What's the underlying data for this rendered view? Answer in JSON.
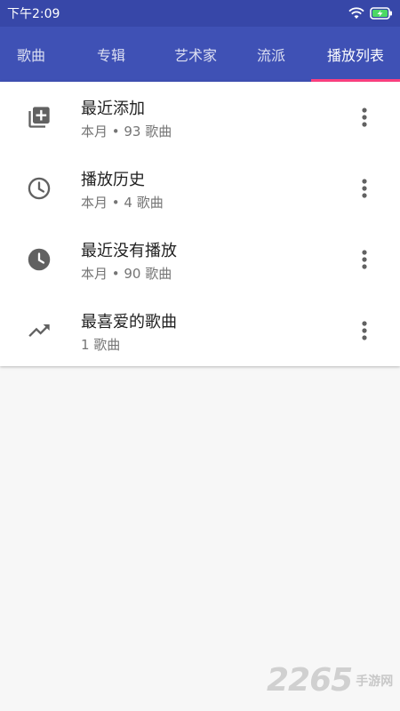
{
  "status_bar": {
    "time": "下午2:09"
  },
  "tabs": [
    {
      "label": "歌曲"
    },
    {
      "label": "专辑"
    },
    {
      "label": "艺术家"
    },
    {
      "label": "流派"
    },
    {
      "label": "播放列表"
    }
  ],
  "accent_color": "#ff4081",
  "playlists": [
    {
      "title": "最近添加",
      "subtitle": "本月 • 93 歌曲",
      "icon": "playlist-add-icon"
    },
    {
      "title": "播放历史",
      "subtitle": "本月 • 4 歌曲",
      "icon": "history-clock-icon"
    },
    {
      "title": "最近没有播放",
      "subtitle": "本月 • 90 歌曲",
      "icon": "clock-filled-icon"
    },
    {
      "title": "最喜爱的歌曲",
      "subtitle": "1 歌曲",
      "icon": "trending-up-icon"
    }
  ],
  "watermark": {
    "number": "2265",
    "text": "手游网"
  }
}
